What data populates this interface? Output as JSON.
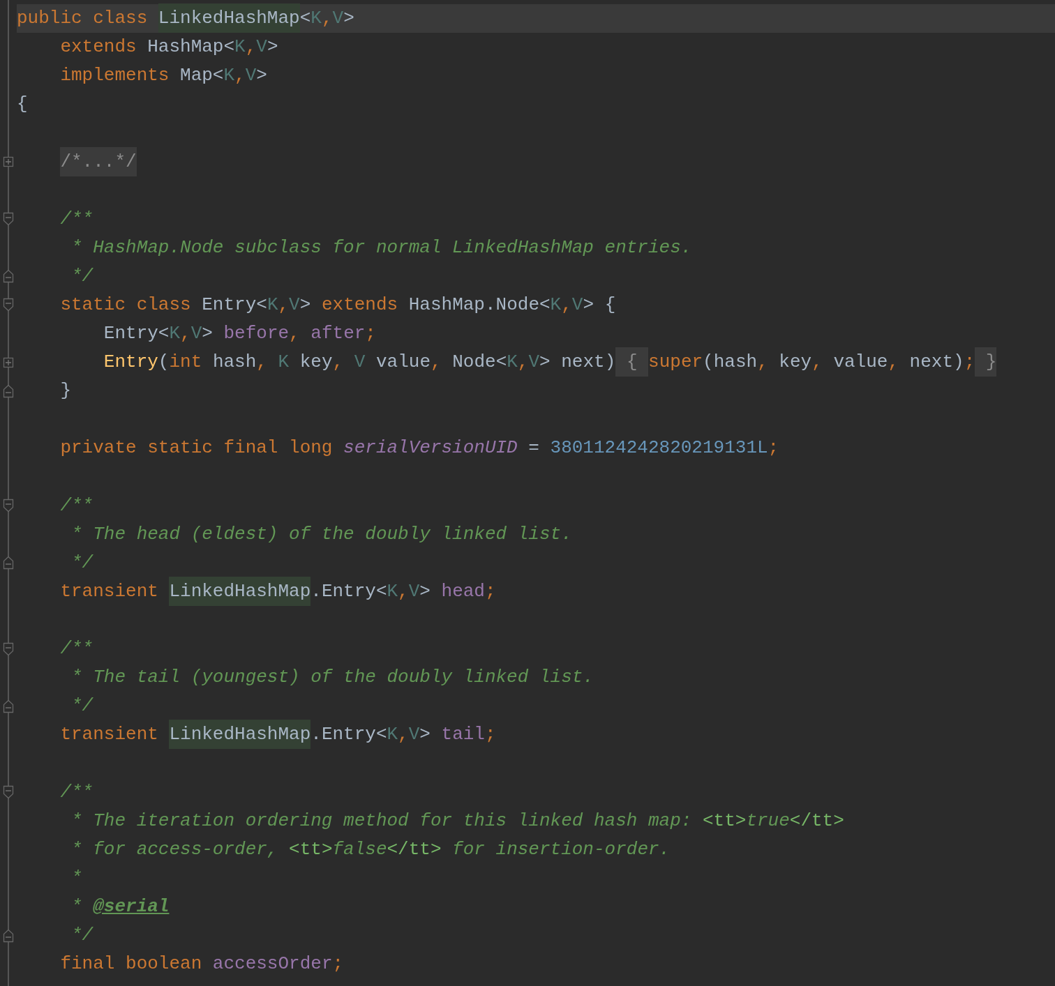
{
  "editor": {
    "lines": [
      {
        "current": true,
        "kind": "plain",
        "tokens": [
          {
            "kind": "kw",
            "t": "public class "
          },
          {
            "kind": "hl",
            "t": "LinkedHashMap"
          },
          {
            "kind": "plain",
            "t": "<"
          },
          {
            "kind": "tp",
            "t": "K"
          },
          {
            "kind": "punct",
            "t": ","
          },
          {
            "kind": "tp",
            "t": "V"
          },
          {
            "kind": "plain",
            "t": ">"
          }
        ]
      },
      {
        "current": false,
        "kind": "plain",
        "tokens": [
          {
            "kind": "kw",
            "t": "    extends "
          },
          {
            "kind": "plain",
            "t": "HashMap<"
          },
          {
            "kind": "tp",
            "t": "K"
          },
          {
            "kind": "punct",
            "t": ","
          },
          {
            "kind": "tp",
            "t": "V"
          },
          {
            "kind": "plain",
            "t": ">"
          }
        ]
      },
      {
        "current": false,
        "kind": "plain",
        "tokens": [
          {
            "kind": "kw",
            "t": "    implements "
          },
          {
            "kind": "plain",
            "t": "Map<"
          },
          {
            "kind": "tp",
            "t": "K"
          },
          {
            "kind": "punct",
            "t": ","
          },
          {
            "kind": "tp",
            "t": "V"
          },
          {
            "kind": "plain",
            "t": ">"
          }
        ]
      },
      {
        "current": false,
        "kind": "plain",
        "tokens": [
          {
            "kind": "plain",
            "t": "{"
          }
        ]
      },
      {
        "current": false,
        "kind": "plain"
      },
      {
        "current": false,
        "kind": "plus",
        "tokens": [
          {
            "kind": "folded",
            "t": "/*...*/",
            "indent": true
          }
        ]
      },
      {
        "current": false,
        "kind": "plain"
      },
      {
        "current": false,
        "kind": "open",
        "tokens": [
          {
            "kind": "doc",
            "t": "    /**"
          }
        ]
      },
      {
        "current": false,
        "kind": "plain",
        "tokens": [
          {
            "kind": "doc",
            "t": "     * HashMap.Node subclass for normal LinkedHashMap entries."
          }
        ]
      },
      {
        "current": false,
        "kind": "close",
        "tokens": [
          {
            "kind": "doc",
            "t": "     */"
          }
        ]
      },
      {
        "current": false,
        "kind": "open",
        "tokens": [
          {
            "kind": "kw",
            "t": "    static class "
          },
          {
            "kind": "plain",
            "t": "Entry<"
          },
          {
            "kind": "tp",
            "t": "K"
          },
          {
            "kind": "punct",
            "t": ","
          },
          {
            "kind": "tp",
            "t": "V"
          },
          {
            "kind": "plain",
            "t": "> "
          },
          {
            "kind": "kw",
            "t": "extends "
          },
          {
            "kind": "plain",
            "t": "HashMap.Node<"
          },
          {
            "kind": "tp",
            "t": "K"
          },
          {
            "kind": "punct",
            "t": ","
          },
          {
            "kind": "tp",
            "t": "V"
          },
          {
            "kind": "plain",
            "t": "> {"
          }
        ]
      },
      {
        "current": false,
        "kind": "plain",
        "tokens": [
          {
            "kind": "plain",
            "t": "        Entry<"
          },
          {
            "kind": "tp",
            "t": "K"
          },
          {
            "kind": "punct",
            "t": ","
          },
          {
            "kind": "tp",
            "t": "V"
          },
          {
            "kind": "plain",
            "t": "> "
          },
          {
            "kind": "field",
            "t": "before"
          },
          {
            "kind": "punct",
            "t": ", "
          },
          {
            "kind": "field",
            "t": "after"
          },
          {
            "kind": "punct",
            "t": ";"
          }
        ]
      },
      {
        "current": false,
        "kind": "plus",
        "tokens": [
          {
            "kind": "fn",
            "t": "        Entry"
          },
          {
            "kind": "plain",
            "t": "("
          },
          {
            "kind": "kw",
            "t": "int "
          },
          {
            "kind": "plain",
            "t": "hash"
          },
          {
            "kind": "punct",
            "t": ", "
          },
          {
            "kind": "tp",
            "t": "K "
          },
          {
            "kind": "plain",
            "t": "key"
          },
          {
            "kind": "punct",
            "t": ", "
          },
          {
            "kind": "tp",
            "t": "V "
          },
          {
            "kind": "plain",
            "t": "value"
          },
          {
            "kind": "punct",
            "t": ", "
          },
          {
            "kind": "plain",
            "t": "Node<"
          },
          {
            "kind": "tp",
            "t": "K"
          },
          {
            "kind": "punct",
            "t": ","
          },
          {
            "kind": "tp",
            "t": "V"
          },
          {
            "kind": "plain",
            "t": "> next)"
          },
          {
            "kind": "folded",
            "t": " { "
          },
          {
            "kind": "kw",
            "t": "super"
          },
          {
            "kind": "plain",
            "t": "(hash"
          },
          {
            "kind": "punct",
            "t": ", "
          },
          {
            "kind": "plain",
            "t": "key"
          },
          {
            "kind": "punct",
            "t": ", "
          },
          {
            "kind": "plain",
            "t": "value"
          },
          {
            "kind": "punct",
            "t": ", "
          },
          {
            "kind": "plain",
            "t": "next)"
          },
          {
            "kind": "punct",
            "t": ";"
          },
          {
            "kind": "folded",
            "t": " }"
          }
        ]
      },
      {
        "current": false,
        "kind": "close",
        "tokens": [
          {
            "kind": "plain",
            "t": "    }"
          }
        ]
      },
      {
        "current": false,
        "kind": "plain"
      },
      {
        "current": false,
        "kind": "plain",
        "tokens": [
          {
            "kind": "kw",
            "t": "    private static final long "
          },
          {
            "kind": "static",
            "t": "serialVersionUID"
          },
          {
            "kind": "plain",
            "t": " = "
          },
          {
            "kind": "num",
            "t": "3801124242820219131L"
          },
          {
            "kind": "punct",
            "t": ";"
          }
        ]
      },
      {
        "current": false,
        "kind": "plain"
      },
      {
        "current": false,
        "kind": "open",
        "tokens": [
          {
            "kind": "doc",
            "t": "    /**"
          }
        ]
      },
      {
        "current": false,
        "kind": "plain",
        "tokens": [
          {
            "kind": "doc",
            "t": "     * The head (eldest) of the doubly linked list."
          }
        ]
      },
      {
        "current": false,
        "kind": "close",
        "tokens": [
          {
            "kind": "doc",
            "t": "     */"
          }
        ]
      },
      {
        "current": false,
        "kind": "plain",
        "tokens": [
          {
            "kind": "kw",
            "t": "    transient "
          },
          {
            "kind": "hl",
            "t": "LinkedHashMap"
          },
          {
            "kind": "plain",
            "t": ".Entry<"
          },
          {
            "kind": "tp",
            "t": "K"
          },
          {
            "kind": "punct",
            "t": ","
          },
          {
            "kind": "tp",
            "t": "V"
          },
          {
            "kind": "plain",
            "t": "> "
          },
          {
            "kind": "field",
            "t": "head"
          },
          {
            "kind": "punct",
            "t": ";"
          }
        ]
      },
      {
        "current": false,
        "kind": "plain"
      },
      {
        "current": false,
        "kind": "open",
        "tokens": [
          {
            "kind": "doc",
            "t": "    /**"
          }
        ]
      },
      {
        "current": false,
        "kind": "plain",
        "tokens": [
          {
            "kind": "doc",
            "t": "     * The tail (youngest) of the doubly linked list."
          }
        ]
      },
      {
        "current": false,
        "kind": "close",
        "tokens": [
          {
            "kind": "doc",
            "t": "     */"
          }
        ]
      },
      {
        "current": false,
        "kind": "plain",
        "tokens": [
          {
            "kind": "kw",
            "t": "    transient "
          },
          {
            "kind": "hl",
            "t": "LinkedHashMap"
          },
          {
            "kind": "plain",
            "t": ".Entry<"
          },
          {
            "kind": "tp",
            "t": "K"
          },
          {
            "kind": "punct",
            "t": ","
          },
          {
            "kind": "tp",
            "t": "V"
          },
          {
            "kind": "plain",
            "t": "> "
          },
          {
            "kind": "field",
            "t": "tail"
          },
          {
            "kind": "punct",
            "t": ";"
          }
        ]
      },
      {
        "current": false,
        "kind": "plain"
      },
      {
        "current": false,
        "kind": "open",
        "tokens": [
          {
            "kind": "doc",
            "t": "    /**"
          }
        ]
      },
      {
        "current": false,
        "kind": "plain",
        "tokens": [
          {
            "kind": "doc",
            "t": "     * The iteration ordering method for this linked hash map: "
          },
          {
            "kind": "markup",
            "t": "<tt>"
          },
          {
            "kind": "doc",
            "t": "true"
          },
          {
            "kind": "markup",
            "t": "</tt>"
          }
        ]
      },
      {
        "current": false,
        "kind": "plain",
        "tokens": [
          {
            "kind": "doc",
            "t": "     * for access-order, "
          },
          {
            "kind": "markup",
            "t": "<tt>"
          },
          {
            "kind": "doc",
            "t": "false"
          },
          {
            "kind": "markup",
            "t": "</tt>"
          },
          {
            "kind": "doc",
            "t": " for insertion-order."
          }
        ]
      },
      {
        "current": false,
        "kind": "plain",
        "tokens": [
          {
            "kind": "doc",
            "t": "     *"
          }
        ]
      },
      {
        "current": false,
        "kind": "plain",
        "tokens": [
          {
            "kind": "doc",
            "t": "     * "
          },
          {
            "kind": "doctag",
            "t": "@serial"
          }
        ]
      },
      {
        "current": false,
        "kind": "close",
        "tokens": [
          {
            "kind": "doc",
            "t": "     */"
          }
        ]
      },
      {
        "current": false,
        "kind": "plain",
        "tokens": [
          {
            "kind": "kw",
            "t": "    final boolean "
          },
          {
            "kind": "field",
            "t": "accessOrder"
          },
          {
            "kind": "punct",
            "t": ";"
          }
        ]
      }
    ]
  }
}
